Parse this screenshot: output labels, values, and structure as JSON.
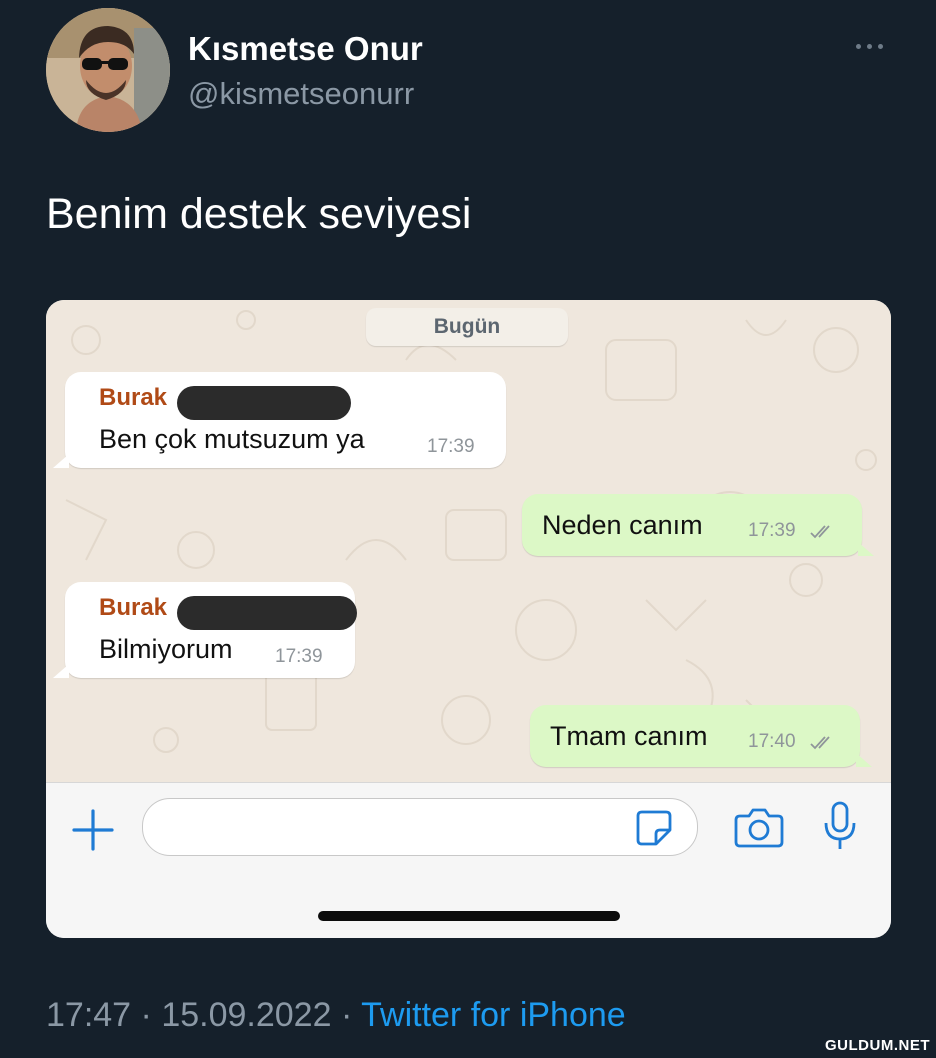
{
  "tweet": {
    "author_name": "Kısmetse Onur",
    "author_handle": "@kismetseonurr",
    "text": "Benim destek seviyesi",
    "time": "17:47",
    "separator": "·",
    "date": "15.09.2022",
    "source": "Twitter for iPhone"
  },
  "chat": {
    "date_label": "Bugün",
    "messages": [
      {
        "direction": "incoming",
        "sender": "Burak",
        "text": "Ben çok mutsuzum ya",
        "time": "17:39"
      },
      {
        "direction": "outgoing",
        "text": "Neden canım",
        "time": "17:39",
        "status": "read"
      },
      {
        "direction": "incoming",
        "sender": "Burak",
        "text": "Bilmiyorum",
        "time": "17:39"
      },
      {
        "direction": "outgoing",
        "text": "Tmam canım",
        "time": "17:40",
        "status": "read"
      }
    ],
    "input_icons": [
      "plus-icon",
      "sticker-icon",
      "camera-icon",
      "microphone-icon"
    ]
  },
  "watermark": "GULDUM.NET",
  "colors": {
    "background": "#15202b",
    "link": "#1d9bf0",
    "muted": "#8b98a5",
    "incoming_bubble": "#ffffff",
    "outgoing_bubble": "#dcf8c6",
    "sender_name": "#b04a16",
    "whatsapp_icon_blue": "#1f7bd4"
  }
}
